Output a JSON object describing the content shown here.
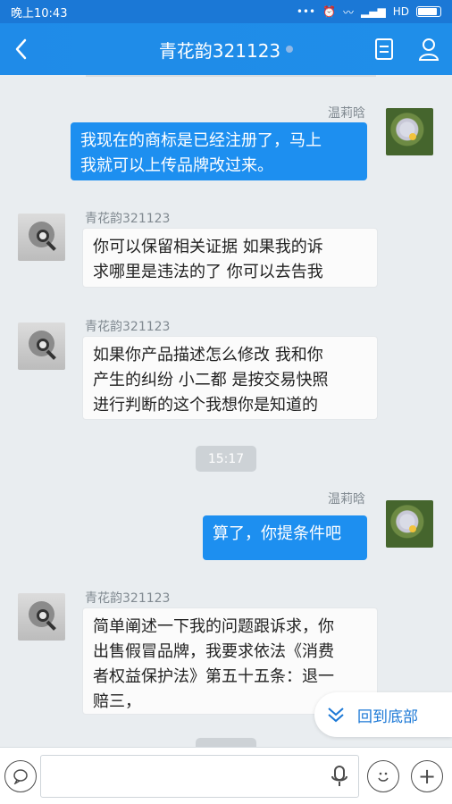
{
  "status": {
    "time": "晚上10:43",
    "network": "HD"
  },
  "header": {
    "title": "青花韵321123"
  },
  "chat": {
    "messages": [
      {
        "sender": "温莉晗",
        "text_lines": [
          "我现在的商标是已经注册了，马上",
          "我就可以上传品牌改过来。"
        ]
      },
      {
        "sender": "青花韵321123",
        "text_lines": [
          "你可以保留相关证据  如果我的诉",
          "求哪里是违法的了  你可以去告我"
        ]
      },
      {
        "sender": "青花韵321123",
        "text_lines": [
          "如果你产品描述怎么修改 我和你",
          "产生的纠纷 小二都 是按交易快照",
          "进行判断的这个我想你是知道的"
        ]
      },
      {
        "sender": "温莉晗",
        "text_lines": [
          "算了，你提条件吧"
        ]
      },
      {
        "sender": "青花韵321123",
        "text_lines": [
          "简单阐述一下我的问题跟诉求，你",
          "出售假冒品牌，我要求依法《消费",
          "者权益保护法》第五十五条：退一",
          "赔三，"
        ]
      }
    ],
    "timestamp": "15:17"
  },
  "controls": {
    "back_to_bottom": "回到底部"
  },
  "colors": {
    "accent": "#1d8ff0",
    "background": "#e9edf0"
  },
  "icons": [
    "back-arrow-icon",
    "document-icon",
    "profile-icon",
    "chat-bubble-icon",
    "microphone-icon",
    "emoji-icon",
    "plus-icon",
    "double-chevron-down-icon"
  ]
}
